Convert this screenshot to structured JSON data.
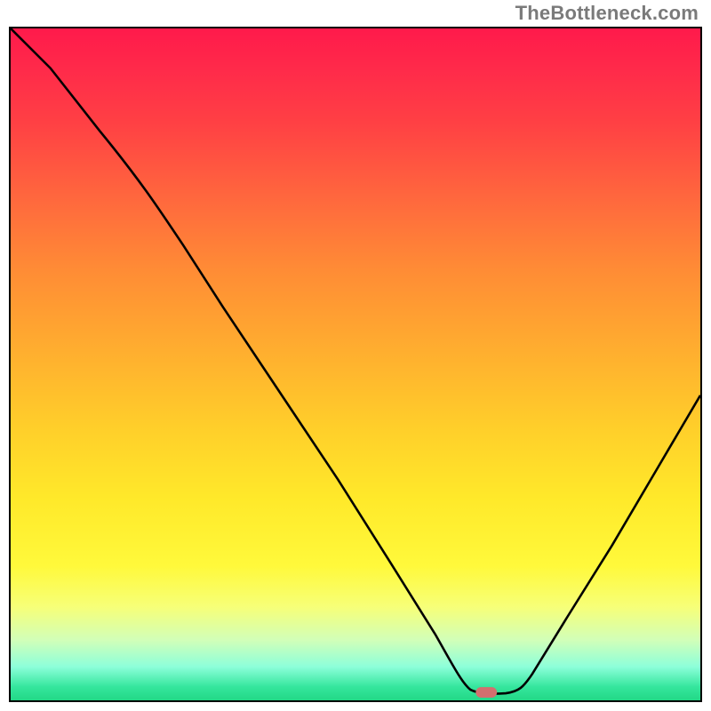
{
  "watermark": "TheBottleneck.com",
  "chart_data": {
    "type": "line",
    "title": "",
    "xlabel": "",
    "ylabel": "",
    "xlim": [
      0,
      100
    ],
    "ylim": [
      0,
      100
    ],
    "series": [
      {
        "name": "curve",
        "x": [
          0,
          5,
          12,
          20,
          25,
          30,
          35,
          40,
          45,
          50,
          55,
          60,
          65,
          66,
          70,
          72,
          75,
          80,
          85,
          90,
          95,
          100
        ],
        "values": [
          100,
          94,
          85,
          75,
          69,
          63,
          55,
          47,
          38,
          30,
          21,
          12,
          2,
          1,
          1,
          1,
          4,
          12,
          21,
          30,
          40,
          50
        ]
      }
    ],
    "marker": {
      "x": 69,
      "y": 0.7,
      "color": "#d36f6f"
    },
    "gradient_stops": [
      {
        "pos": 0.0,
        "color": "#ff1a4b"
      },
      {
        "pos": 0.14,
        "color": "#ff4044"
      },
      {
        "pos": 0.36,
        "color": "#ff8c35"
      },
      {
        "pos": 0.6,
        "color": "#ffd02a"
      },
      {
        "pos": 0.8,
        "color": "#fff93b"
      },
      {
        "pos": 0.95,
        "color": "#8dffda"
      },
      {
        "pos": 1.0,
        "color": "#22d886"
      }
    ]
  }
}
